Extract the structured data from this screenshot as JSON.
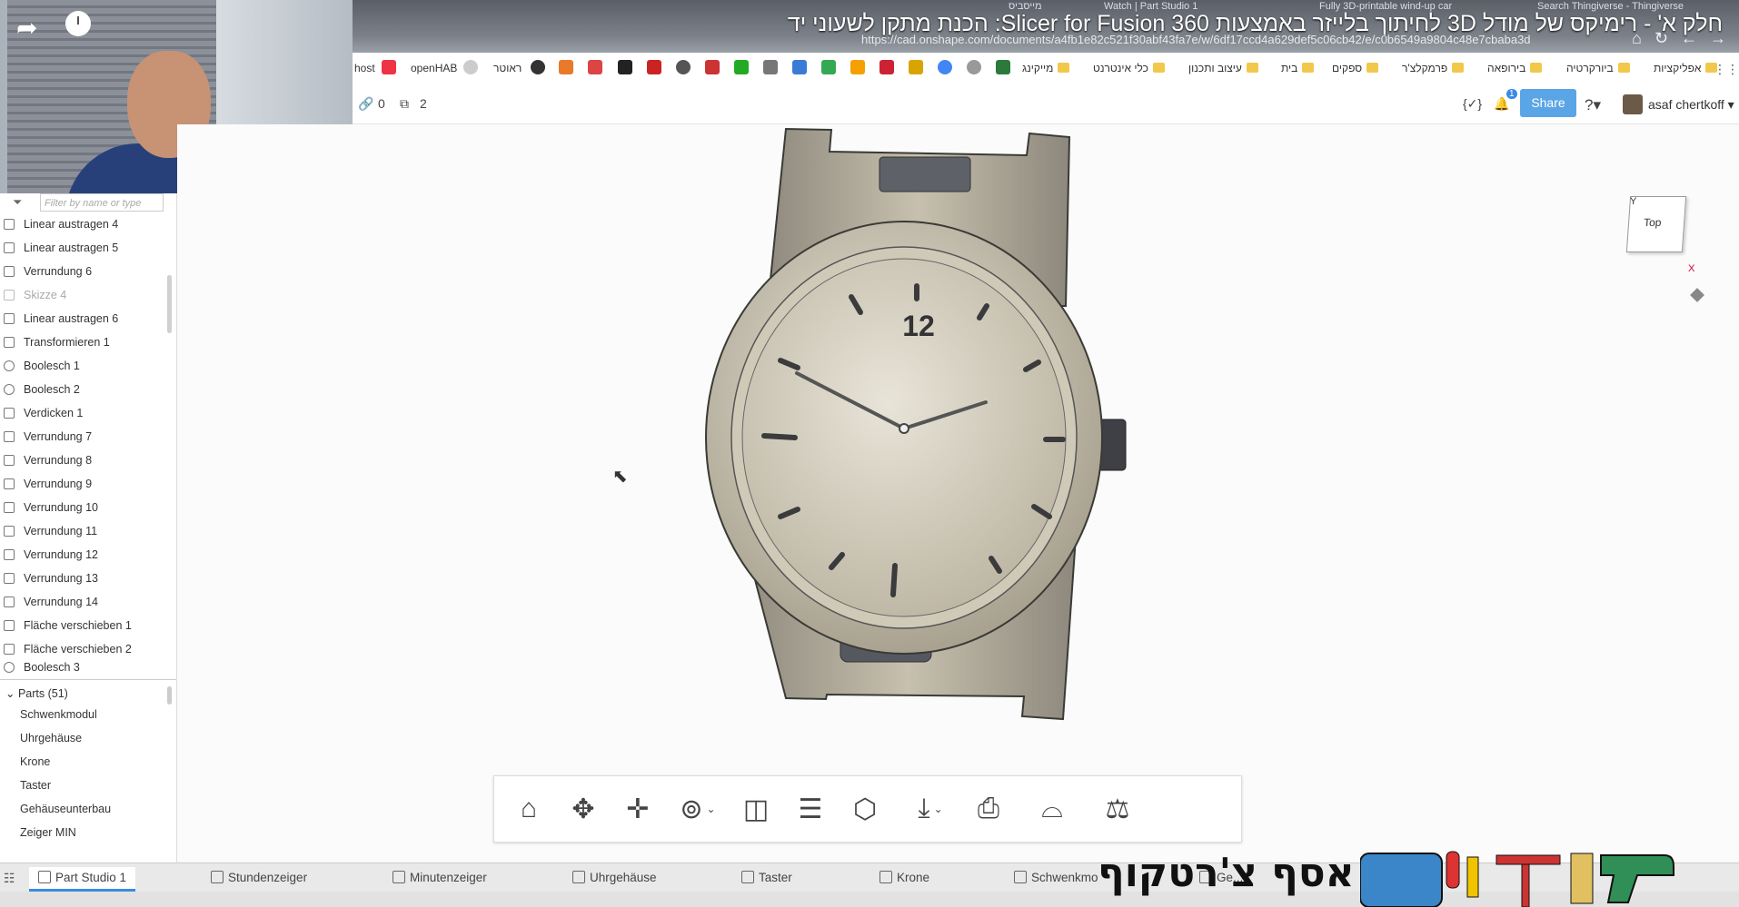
{
  "video": {
    "title": "חלק א' - רימיקס של מודל 3D לחיתוך בלייזר באמצעות Slicer for Fusion 360: הכנת מתקן לשעוני יד"
  },
  "browser": {
    "tabs": [
      "מייסביס",
      "Watch | Part Studio 1",
      "Fully 3D-printable wind-up car",
      "Search Thingiverse - Thingiverse"
    ],
    "url": "https://cad.onshape.com/documents/a4fb1e82c521f30abf43fa7e/w/6df17ccd4a629def5c06cb42/e/c0b6549a9804c48e7cbaba3d",
    "bookmarks": [
      "host",
      "openHAB",
      "ראוטר",
      "מייקינג",
      "כלי אינטרנט",
      "עיצוב ותכנון",
      "בית",
      "ספקים",
      "פרמקלצ'ר",
      "בירופאה",
      "ביורקרטיה",
      "אפליקציות"
    ]
  },
  "header": {
    "link_count": "0",
    "copy_count": "2",
    "share_label": "Share",
    "notification_count": "1",
    "user_name": "asaf chertkoff"
  },
  "feature_tree": {
    "filter_placeholder": "Filter by name or type",
    "features": [
      {
        "label": "Linear austragen 4",
        "dim": false
      },
      {
        "label": "Linear austragen 5",
        "dim": false
      },
      {
        "label": "Verrundung 6",
        "dim": false
      },
      {
        "label": "Skizze 4",
        "dim": true
      },
      {
        "label": "Linear austragen 6",
        "dim": false
      },
      {
        "label": "Transformieren 1",
        "dim": false
      },
      {
        "label": "Boolesch 1",
        "dim": false
      },
      {
        "label": "Boolesch 2",
        "dim": false
      },
      {
        "label": "Verdicken 1",
        "dim": false
      },
      {
        "label": "Verrundung 7",
        "dim": false
      },
      {
        "label": "Verrundung 8",
        "dim": false
      },
      {
        "label": "Verrundung 9",
        "dim": false
      },
      {
        "label": "Verrundung 10",
        "dim": false
      },
      {
        "label": "Verrundung 11",
        "dim": false
      },
      {
        "label": "Verrundung 12",
        "dim": false
      },
      {
        "label": "Verrundung 13",
        "dim": false
      },
      {
        "label": "Verrundung 14",
        "dim": false
      },
      {
        "label": "Fläche verschieben 1",
        "dim": false
      },
      {
        "label": "Fläche verschieben 2",
        "dim": false
      },
      {
        "label": "Boolesch 3",
        "dim": false
      }
    ],
    "parts_header": "Parts (51)",
    "parts": [
      "Schwenkmodul",
      "Uhrgehäuse",
      "Krone",
      "Taster",
      "Gehäuseunterbau",
      "Zeiger MIN"
    ]
  },
  "viewport": {
    "dial_number": "12",
    "viewcube_label": "Top",
    "axis_y": "Y",
    "axis_x": "X"
  },
  "toolbar": {
    "buttons": [
      "home-icon",
      "rotate-icon",
      "pan-icon",
      "zoom-icon",
      "section-icon",
      "list-icon",
      "cube-icon",
      "download-icon",
      "print-icon",
      "measure-icon",
      "balance-icon"
    ]
  },
  "bottom_tabs": [
    "Part Studio 1",
    "Stundenzeiger",
    "Minutenzeiger",
    "Uhrgehäuse",
    "Taster",
    "Krone",
    "Schwenkmo",
    "Ge..."
  ],
  "brand": {
    "name": "אסף צ'רטקוף"
  }
}
